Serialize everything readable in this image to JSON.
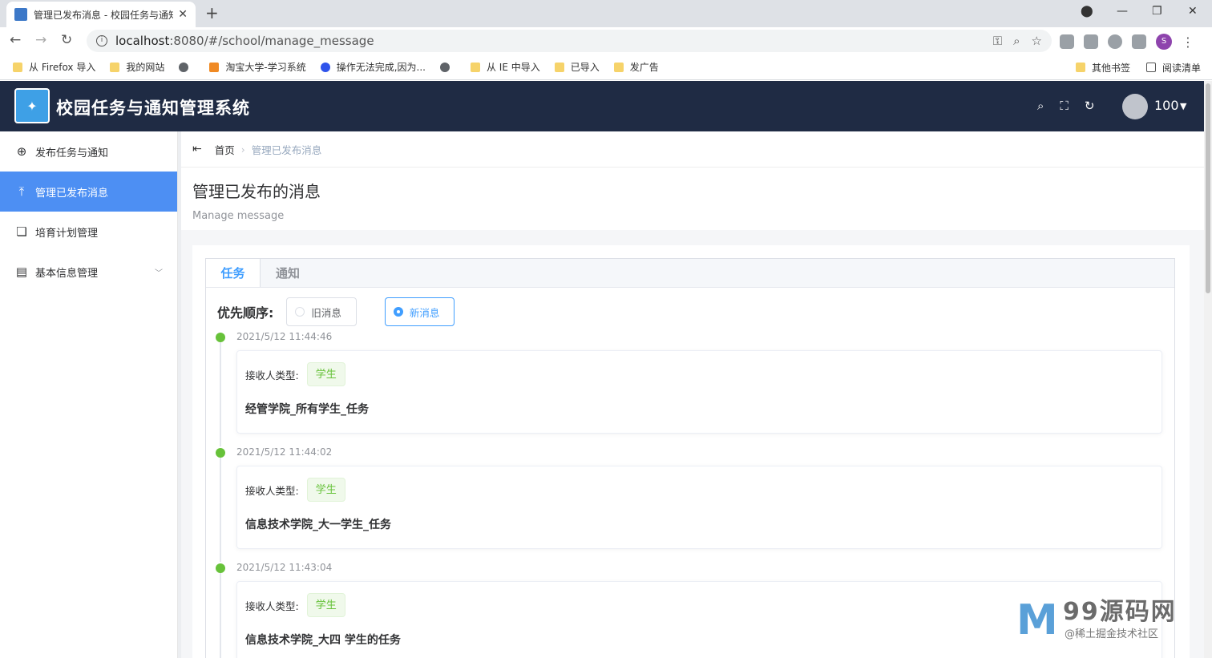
{
  "browser": {
    "tab_title": "管理已发布消息 - 校园任务与通知",
    "url_host": "localhost",
    "url_rest": ":8080/#/school/manage_message",
    "bookmarks": [
      "从 Firefox 导入",
      "我的网站",
      "淘宝大学-学习系统",
      "操作无法完成,因为...",
      "从 IE 中导入",
      "已导入",
      "发广告"
    ],
    "bookmarks_right": [
      "其他书签",
      "阅读清单"
    ],
    "profile_initial": "S"
  },
  "app": {
    "title": "校园任务与通知管理系统",
    "user": "100"
  },
  "sidebar": {
    "items": [
      {
        "label": "发布任务与通知",
        "icon": "plus-circle-icon"
      },
      {
        "label": "管理已发布消息",
        "icon": "upload-icon"
      },
      {
        "label": "培育计划管理",
        "icon": "book-icon"
      },
      {
        "label": "基本信息管理",
        "icon": "document-icon"
      }
    ]
  },
  "breadcrumb": {
    "home": "首页",
    "current": "管理已发布消息"
  },
  "page": {
    "title": "管理已发布的消息",
    "subtitle": "Manage message"
  },
  "tabs": [
    "任务",
    "通知"
  ],
  "order": {
    "label": "优先顺序:",
    "options": [
      "旧消息",
      "新消息"
    ],
    "selected": "新消息"
  },
  "messages": [
    {
      "time": "2021/5/12 11:44:46",
      "recv_label": "接收人类型:",
      "recv_type": "学生",
      "content": "经管学院_所有学生_任务"
    },
    {
      "time": "2021/5/12 11:44:02",
      "recv_label": "接收人类型:",
      "recv_type": "学生",
      "content": "信息技术学院_大一学生_任务"
    },
    {
      "time": "2021/5/12 11:43:04",
      "recv_label": "接收人类型:",
      "recv_type": "学生",
      "content": "信息技术学院_大四 学生的任务"
    }
  ],
  "watermark": {
    "brand": "99源码网",
    "sub": "@稀土掘金技术社区"
  },
  "colors": {
    "header_bg": "#1f2b44",
    "active_menu": "#4d8ff3",
    "primary": "#409eff",
    "success": "#67c23a"
  }
}
